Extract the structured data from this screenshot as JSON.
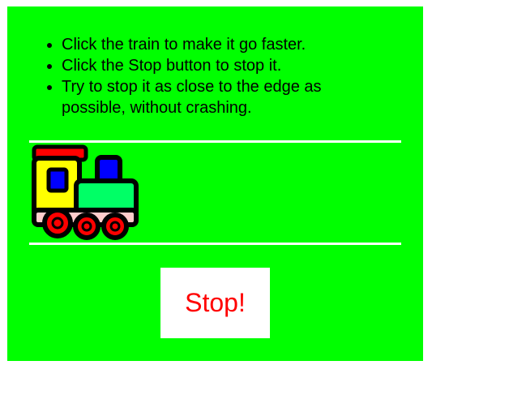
{
  "instructions": [
    "Click the train to make it go faster.",
    "Click the Stop button to stop it.",
    "Try to stop it as close to the edge as possible, without crashing."
  ],
  "stop_button": {
    "label": "Stop!"
  },
  "colors": {
    "background": "#00ff00",
    "track": "#ffffff",
    "button_text": "#ff0000",
    "train_body": "#ffff00",
    "train_tender": "#00ff66",
    "train_window": "#0000ff",
    "train_wheels": "#ff0000"
  },
  "train": {
    "icon": "toy-train-icon"
  }
}
